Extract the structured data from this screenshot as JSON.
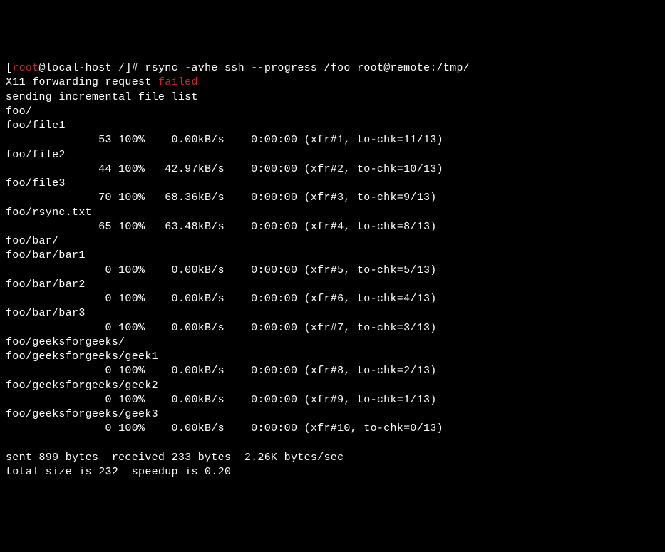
{
  "prompt": {
    "open": "[",
    "user": "root",
    "at": "@",
    "host": "local-host",
    "path": " /",
    "close": "]",
    "hash": "# "
  },
  "command": "rsync -avhe ssh --progress /foo root@remote:/tmp/",
  "x11_prefix": "X11 forwarding request ",
  "x11_failed": "failed",
  "sending": "sending incremental file list",
  "entries": [
    {
      "type": "dir",
      "path": "foo/"
    },
    {
      "type": "file",
      "path": "foo/file1",
      "size": "53",
      "pct": "100%",
      "rate": "0.00kB/s",
      "time": "0:00:00",
      "xfr": "(xfr#1, to-chk=11/13)"
    },
    {
      "type": "file",
      "path": "foo/file2",
      "size": "44",
      "pct": "100%",
      "rate": "42.97kB/s",
      "time": "0:00:00",
      "xfr": "(xfr#2, to-chk=10/13)"
    },
    {
      "type": "file",
      "path": "foo/file3",
      "size": "70",
      "pct": "100%",
      "rate": "68.36kB/s",
      "time": "0:00:00",
      "xfr": "(xfr#3, to-chk=9/13)"
    },
    {
      "type": "file",
      "path": "foo/rsync.txt",
      "size": "65",
      "pct": "100%",
      "rate": "63.48kB/s",
      "time": "0:00:00",
      "xfr": "(xfr#4, to-chk=8/13)"
    },
    {
      "type": "dir",
      "path": "foo/bar/"
    },
    {
      "type": "file",
      "path": "foo/bar/bar1",
      "size": "0",
      "pct": "100%",
      "rate": "0.00kB/s",
      "time": "0:00:00",
      "xfr": "(xfr#5, to-chk=5/13)"
    },
    {
      "type": "file",
      "path": "foo/bar/bar2",
      "size": "0",
      "pct": "100%",
      "rate": "0.00kB/s",
      "time": "0:00:00",
      "xfr": "(xfr#6, to-chk=4/13)"
    },
    {
      "type": "file",
      "path": "foo/bar/bar3",
      "size": "0",
      "pct": "100%",
      "rate": "0.00kB/s",
      "time": "0:00:00",
      "xfr": "(xfr#7, to-chk=3/13)"
    },
    {
      "type": "dir",
      "path": "foo/geeksforgeeks/"
    },
    {
      "type": "file",
      "path": "foo/geeksforgeeks/geek1",
      "size": "0",
      "pct": "100%",
      "rate": "0.00kB/s",
      "time": "0:00:00",
      "xfr": "(xfr#8, to-chk=2/13)"
    },
    {
      "type": "file",
      "path": "foo/geeksforgeeks/geek2",
      "size": "0",
      "pct": "100%",
      "rate": "0.00kB/s",
      "time": "0:00:00",
      "xfr": "(xfr#9, to-chk=1/13)"
    },
    {
      "type": "file",
      "path": "foo/geeksforgeeks/geek3",
      "size": "0",
      "pct": "100%",
      "rate": "0.00kB/s",
      "time": "0:00:00",
      "xfr": "(xfr#10, to-chk=0/13)"
    }
  ],
  "summary1": "sent 899 bytes  received 233 bytes  2.26K bytes/sec",
  "summary2": "total size is 232  speedup is 0.20"
}
